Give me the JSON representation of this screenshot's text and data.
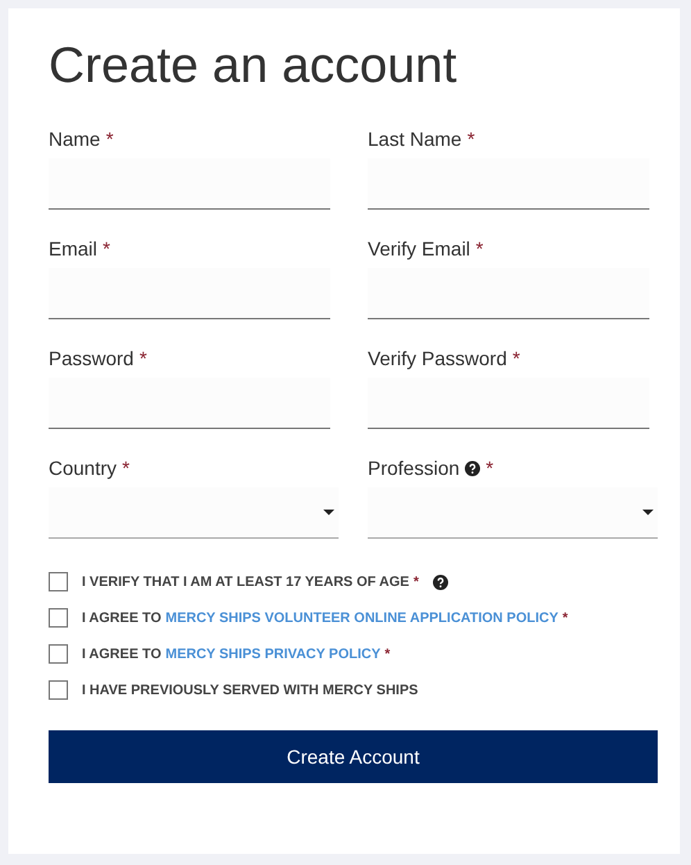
{
  "title": "Create an account",
  "fields": [
    {
      "kind": "text",
      "label": "Name",
      "required_mark": "*"
    },
    {
      "kind": "text",
      "label": "Last Name",
      "required_mark": "*"
    },
    {
      "kind": "text",
      "label": "Email",
      "required_mark": "*"
    },
    {
      "kind": "text",
      "label": "Verify Email",
      "required_mark": "*"
    },
    {
      "kind": "text",
      "label": "Password",
      "required_mark": "*"
    },
    {
      "kind": "text",
      "label": "Verify Password",
      "required_mark": "*"
    },
    {
      "kind": "select",
      "label": "Country",
      "required_mark": "*"
    },
    {
      "kind": "select",
      "label": "Profession",
      "required_mark": "*",
      "help": true
    }
  ],
  "checkboxes": [
    {
      "checked": false,
      "help": true,
      "segments": [
        {
          "kind": "text",
          "text": "I VERIFY THAT I AM AT LEAST 17 YEARS OF AGE"
        },
        {
          "kind": "star",
          "text": "*"
        }
      ]
    },
    {
      "checked": false,
      "segments": [
        {
          "kind": "text",
          "text": "I AGREE TO"
        },
        {
          "kind": "link",
          "text": "MERCY SHIPS VOLUNTEER ONLINE APPLICATION POLICY"
        },
        {
          "kind": "star",
          "text": "*"
        }
      ]
    },
    {
      "checked": false,
      "segments": [
        {
          "kind": "text",
          "text": "I AGREE TO"
        },
        {
          "kind": "link",
          "text": "MERCY SHIPS PRIVACY POLICY"
        },
        {
          "kind": "star",
          "text": "*"
        }
      ]
    },
    {
      "checked": false,
      "segments": [
        {
          "kind": "text",
          "text": "I HAVE PREVIOUSLY SERVED WITH MERCY SHIPS"
        }
      ]
    }
  ],
  "submit": "Create Account"
}
